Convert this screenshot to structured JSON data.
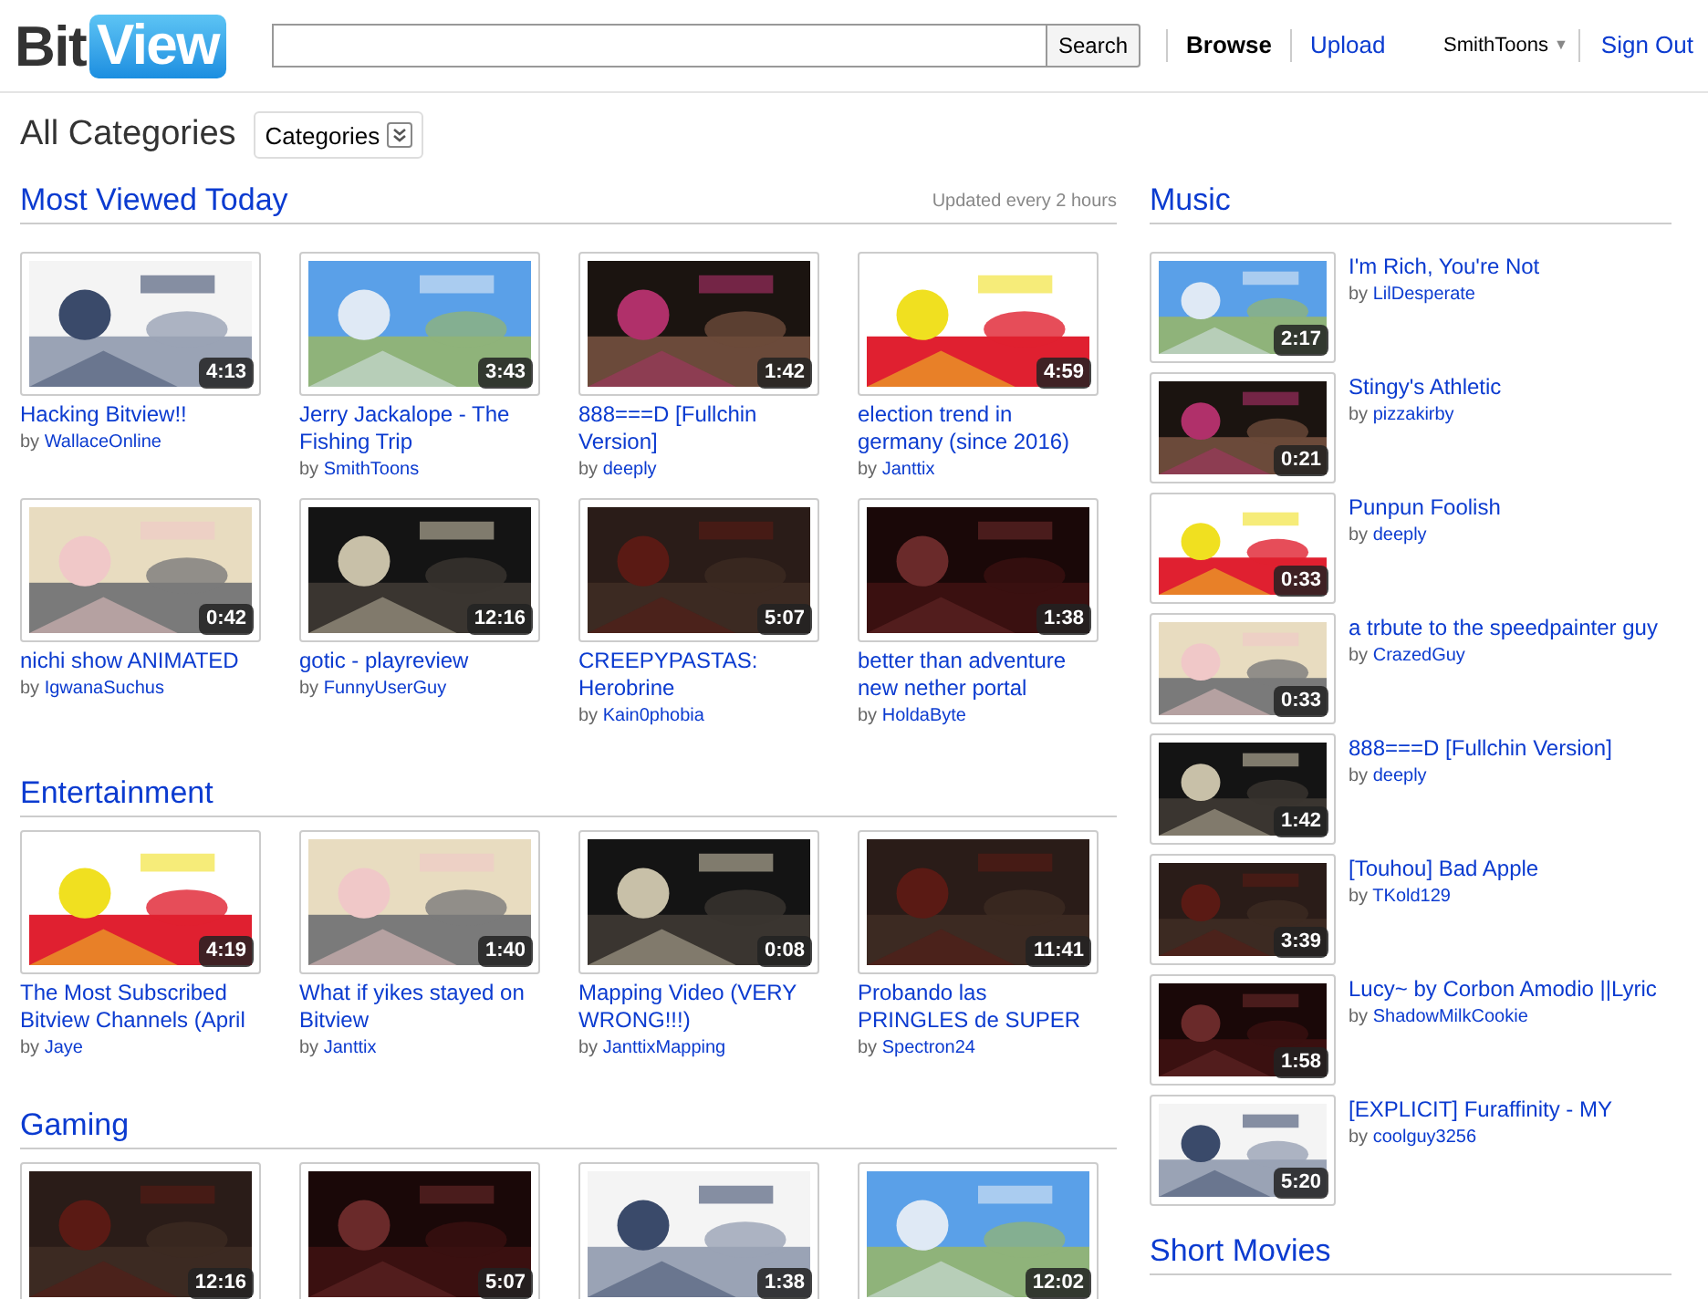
{
  "header": {
    "logo": {
      "first": "Bit",
      "second": "View"
    },
    "search": {
      "button": "Search"
    },
    "nav": [
      {
        "label": "Browse",
        "selected": true
      },
      {
        "label": "Upload",
        "selected": false
      }
    ],
    "user": {
      "name": "SmithToons",
      "menu_icon": "▼"
    },
    "sign_out": "Sign Out"
  },
  "page": {
    "title": "All Categories",
    "dropdown": "Categories"
  },
  "sections": [
    {
      "title": "Most Viewed Today",
      "note": "Updated every 2 hours",
      "videos": [
        {
          "title": "Hacking Bitview!!",
          "by": "by",
          "author": "WallaceOnline",
          "duration": "4:13"
        },
        {
          "title": "Jerry Jackalope - The Fishing Trip",
          "by": "by",
          "author": "SmithToons",
          "duration": "3:43"
        },
        {
          "title": "888===D [Fullchin Version]",
          "by": "by",
          "author": "deeply",
          "duration": "1:42"
        },
        {
          "title": "election trend in germany (since 2016)",
          "by": "by",
          "author": "Janttix",
          "duration": "4:59"
        },
        {
          "title": "nichi show ANIMATED",
          "by": "by",
          "author": "IgwanaSuchus",
          "duration": "0:42"
        },
        {
          "title": "gotic - playreview",
          "by": "by",
          "author": "FunnyUserGuy",
          "duration": "12:16"
        },
        {
          "title": "CREEPYPASTAS: Herobrine",
          "by": "by",
          "author": "Kain0phobia",
          "duration": "5:07"
        },
        {
          "title": "better than adventure new nether portal",
          "by": "by",
          "author": "HoldaByte",
          "duration": "1:38"
        }
      ]
    },
    {
      "title": "Entertainment",
      "videos": [
        {
          "title": "The Most Subscribed Bitview Channels (April",
          "by": "by",
          "author": "Jaye",
          "duration": "4:19"
        },
        {
          "title": "What if yikes stayed on Bitview",
          "by": "by",
          "author": "Janttix",
          "duration": "1:40"
        },
        {
          "title": "Mapping Video (VERY WRONG!!!)",
          "by": "by",
          "author": "JanttixMapping",
          "duration": "0:08"
        },
        {
          "title": "Probando las PRINGLES de SUPER",
          "by": "by",
          "author": "Spectron24",
          "duration": "11:41"
        }
      ]
    },
    {
      "title": "Gaming",
      "videos": [
        {
          "duration": "12:16"
        },
        {
          "duration": "5:07"
        },
        {
          "duration": "1:38"
        },
        {
          "duration": "12:02"
        }
      ]
    }
  ],
  "sidebar": [
    {
      "title": "Music",
      "videos": [
        {
          "title": "I'm Rich, You're Not",
          "by": "by",
          "author": "LilDesperate",
          "duration": "2:17"
        },
        {
          "title": "Stingy's Athletic",
          "by": "by",
          "author": "pizzakirby",
          "duration": "0:21"
        },
        {
          "title": "Punpun Foolish",
          "by": "by",
          "author": "deeply",
          "duration": "0:33"
        },
        {
          "title": "a trbute to the speedpainter guy",
          "by": "by",
          "author": "CrazedGuy",
          "duration": "0:33"
        },
        {
          "title": "888===D [Fullchin Version]",
          "by": "by",
          "author": "deeply",
          "duration": "1:42"
        },
        {
          "title": "[Touhou] Bad Apple",
          "by": "by",
          "author": "TKold129",
          "duration": "3:39"
        },
        {
          "title": "Lucy~ by Corbon Amodio ||Lyric",
          "by": "by",
          "author": "ShadowMilkCookie",
          "duration": "1:58"
        },
        {
          "title": "[EXPLICIT] Furaffinity - MY",
          "by": "by",
          "author": "coolguy3256",
          "duration": "5:20"
        }
      ]
    },
    {
      "title": "Short Movies"
    }
  ]
}
